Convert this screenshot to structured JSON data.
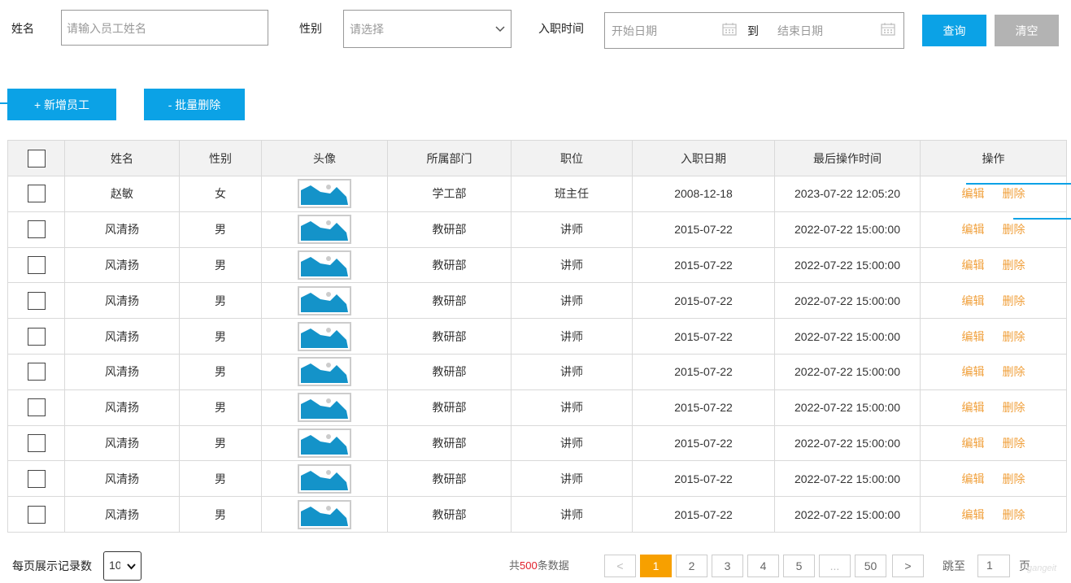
{
  "filters": {
    "name_label": "姓名",
    "name_placeholder": "请输入员工姓名",
    "gender_label": "性别",
    "gender_placeholder": "请选择",
    "date_label": "入职时间",
    "date_start_placeholder": "开始日期",
    "date_to": "到",
    "date_end_placeholder": "结束日期",
    "query_button": "查询",
    "clear_button": "清空"
  },
  "actions": {
    "add_button": "+ 新增员工",
    "batch_delete_button": "- 批量删除"
  },
  "table": {
    "headers": [
      "姓名",
      "性别",
      "头像",
      "所属部门",
      "职位",
      "入职日期",
      "最后操作时间",
      "操作"
    ],
    "edit_label": "编辑",
    "delete_label": "删除",
    "rows": [
      {
        "name": "赵敏",
        "gender": "女",
        "dept": "学工部",
        "position": "班主任",
        "entry_date": "2008-12-18",
        "updated": "2023-07-22 12:05:20"
      },
      {
        "name": "风清扬",
        "gender": "男",
        "dept": "教研部",
        "position": "讲师",
        "entry_date": "2015-07-22",
        "updated": "2022-07-22 15:00:00"
      },
      {
        "name": "风清扬",
        "gender": "男",
        "dept": "教研部",
        "position": "讲师",
        "entry_date": "2015-07-22",
        "updated": "2022-07-22 15:00:00"
      },
      {
        "name": "风清扬",
        "gender": "男",
        "dept": "教研部",
        "position": "讲师",
        "entry_date": "2015-07-22",
        "updated": "2022-07-22 15:00:00"
      },
      {
        "name": "风清扬",
        "gender": "男",
        "dept": "教研部",
        "position": "讲师",
        "entry_date": "2015-07-22",
        "updated": "2022-07-22 15:00:00"
      },
      {
        "name": "风清扬",
        "gender": "男",
        "dept": "教研部",
        "position": "讲师",
        "entry_date": "2015-07-22",
        "updated": "2022-07-22 15:00:00"
      },
      {
        "name": "风清扬",
        "gender": "男",
        "dept": "教研部",
        "position": "讲师",
        "entry_date": "2015-07-22",
        "updated": "2022-07-22 15:00:00"
      },
      {
        "name": "风清扬",
        "gender": "男",
        "dept": "教研部",
        "position": "讲师",
        "entry_date": "2015-07-22",
        "updated": "2022-07-22 15:00:00"
      },
      {
        "name": "风清扬",
        "gender": "男",
        "dept": "教研部",
        "position": "讲师",
        "entry_date": "2015-07-22",
        "updated": "2022-07-22 15:00:00"
      },
      {
        "name": "风清扬",
        "gender": "男",
        "dept": "教研部",
        "position": "讲师",
        "entry_date": "2015-07-22",
        "updated": "2022-07-22 15:00:00"
      }
    ]
  },
  "pagination": {
    "page_size_label": "每页展示记录数",
    "page_size_value": "10",
    "total_prefix": "共",
    "total_count": "500",
    "total_suffix": "条数据",
    "prev": "<",
    "next": ">",
    "pages": [
      "1",
      "2",
      "3",
      "4",
      "5",
      "...",
      "50"
    ],
    "current_page": "1",
    "jump_label": "跳至",
    "jump_value": "1",
    "page_unit": "页"
  },
  "watermark": "gangeit",
  "colors": {
    "primary": "#0ba2e6",
    "accent": "#f7a000",
    "link": "#f0a03c",
    "total_count": "#e0202a"
  }
}
